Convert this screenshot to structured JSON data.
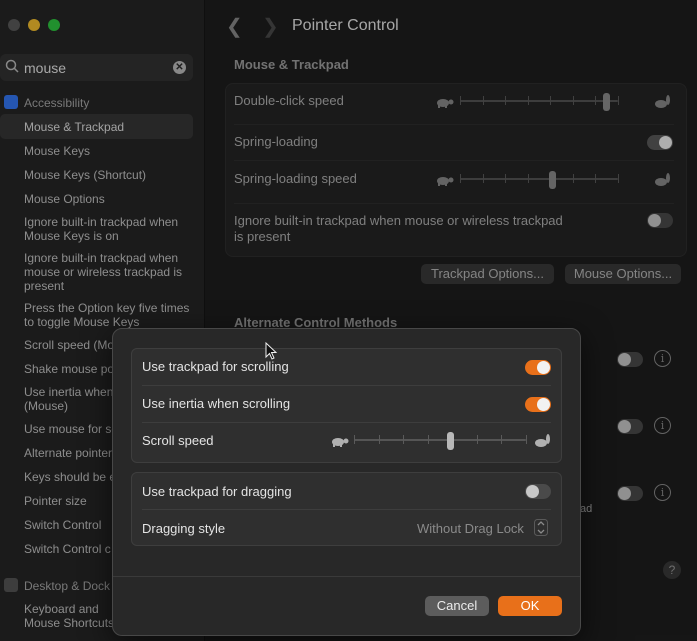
{
  "sidebar": {
    "search": {
      "value": "mouse"
    },
    "sections": [
      {
        "label": "Accessibility",
        "color": "#3478f6"
      },
      {
        "label": "Desktop & Dock",
        "color": "#555555"
      }
    ],
    "items": [
      {
        "label": "Mouse & Trackpad"
      },
      {
        "label": "Mouse Keys"
      },
      {
        "label": "Mouse Keys (Shortcut)"
      },
      {
        "label": "Mouse Options"
      },
      {
        "label": "Ignore built-in trackpad when\nMouse Keys is on"
      },
      {
        "label": "Ignore built-in trackpad when\nmouse or wireless trackpad is\npresent"
      },
      {
        "label": "Press the Option key five times\nto toggle Mouse Keys"
      },
      {
        "label": "Scroll speed (Mo"
      },
      {
        "label": "Shake mouse po"
      },
      {
        "label": "Use inertia when\n(Mouse)"
      },
      {
        "label": "Use mouse for se"
      },
      {
        "label": "Alternate pointer"
      },
      {
        "label": "Keys should be e"
      },
      {
        "label": "Pointer size"
      },
      {
        "label": "Switch Control"
      },
      {
        "label": "Switch Control c"
      },
      {
        "label": "Keyboard and\nMouse Shortcuts"
      }
    ]
  },
  "main": {
    "title": "Pointer Control",
    "section1": "Mouse & Trackpad",
    "rows": [
      {
        "label": "Double-click speed",
        "slider_level": 0.86
      },
      {
        "label": "Spring-loading",
        "toggle": "on"
      },
      {
        "label": "Spring-loading speed",
        "slider_level": 0.5
      },
      {
        "label": "Ignore built-in trackpad when mouse or wireless trackpad\nis present",
        "toggle": "off"
      }
    ],
    "trackpad_options_btn": "Trackpad Options...",
    "mouse_options_btn": "Mouse Options...",
    "section2": "Alternate Control Methods",
    "partial_text": "ad",
    "help": "?"
  },
  "dialog": {
    "use_trackpad_scrolling": {
      "label": "Use trackpad for scrolling",
      "on": true
    },
    "use_inertia_scrolling": {
      "label": "Use inertia when scrolling",
      "on": true
    },
    "scroll_speed": {
      "label": "Scroll speed",
      "level": 0.5
    },
    "use_trackpad_dragging": {
      "label": "Use trackpad for dragging",
      "on": false
    },
    "dragging_style": {
      "label": "Dragging style",
      "value": "Without Drag Lock"
    },
    "cancel_label": "Cancel",
    "ok_label": "OK",
    "accent": "#e8701a"
  }
}
